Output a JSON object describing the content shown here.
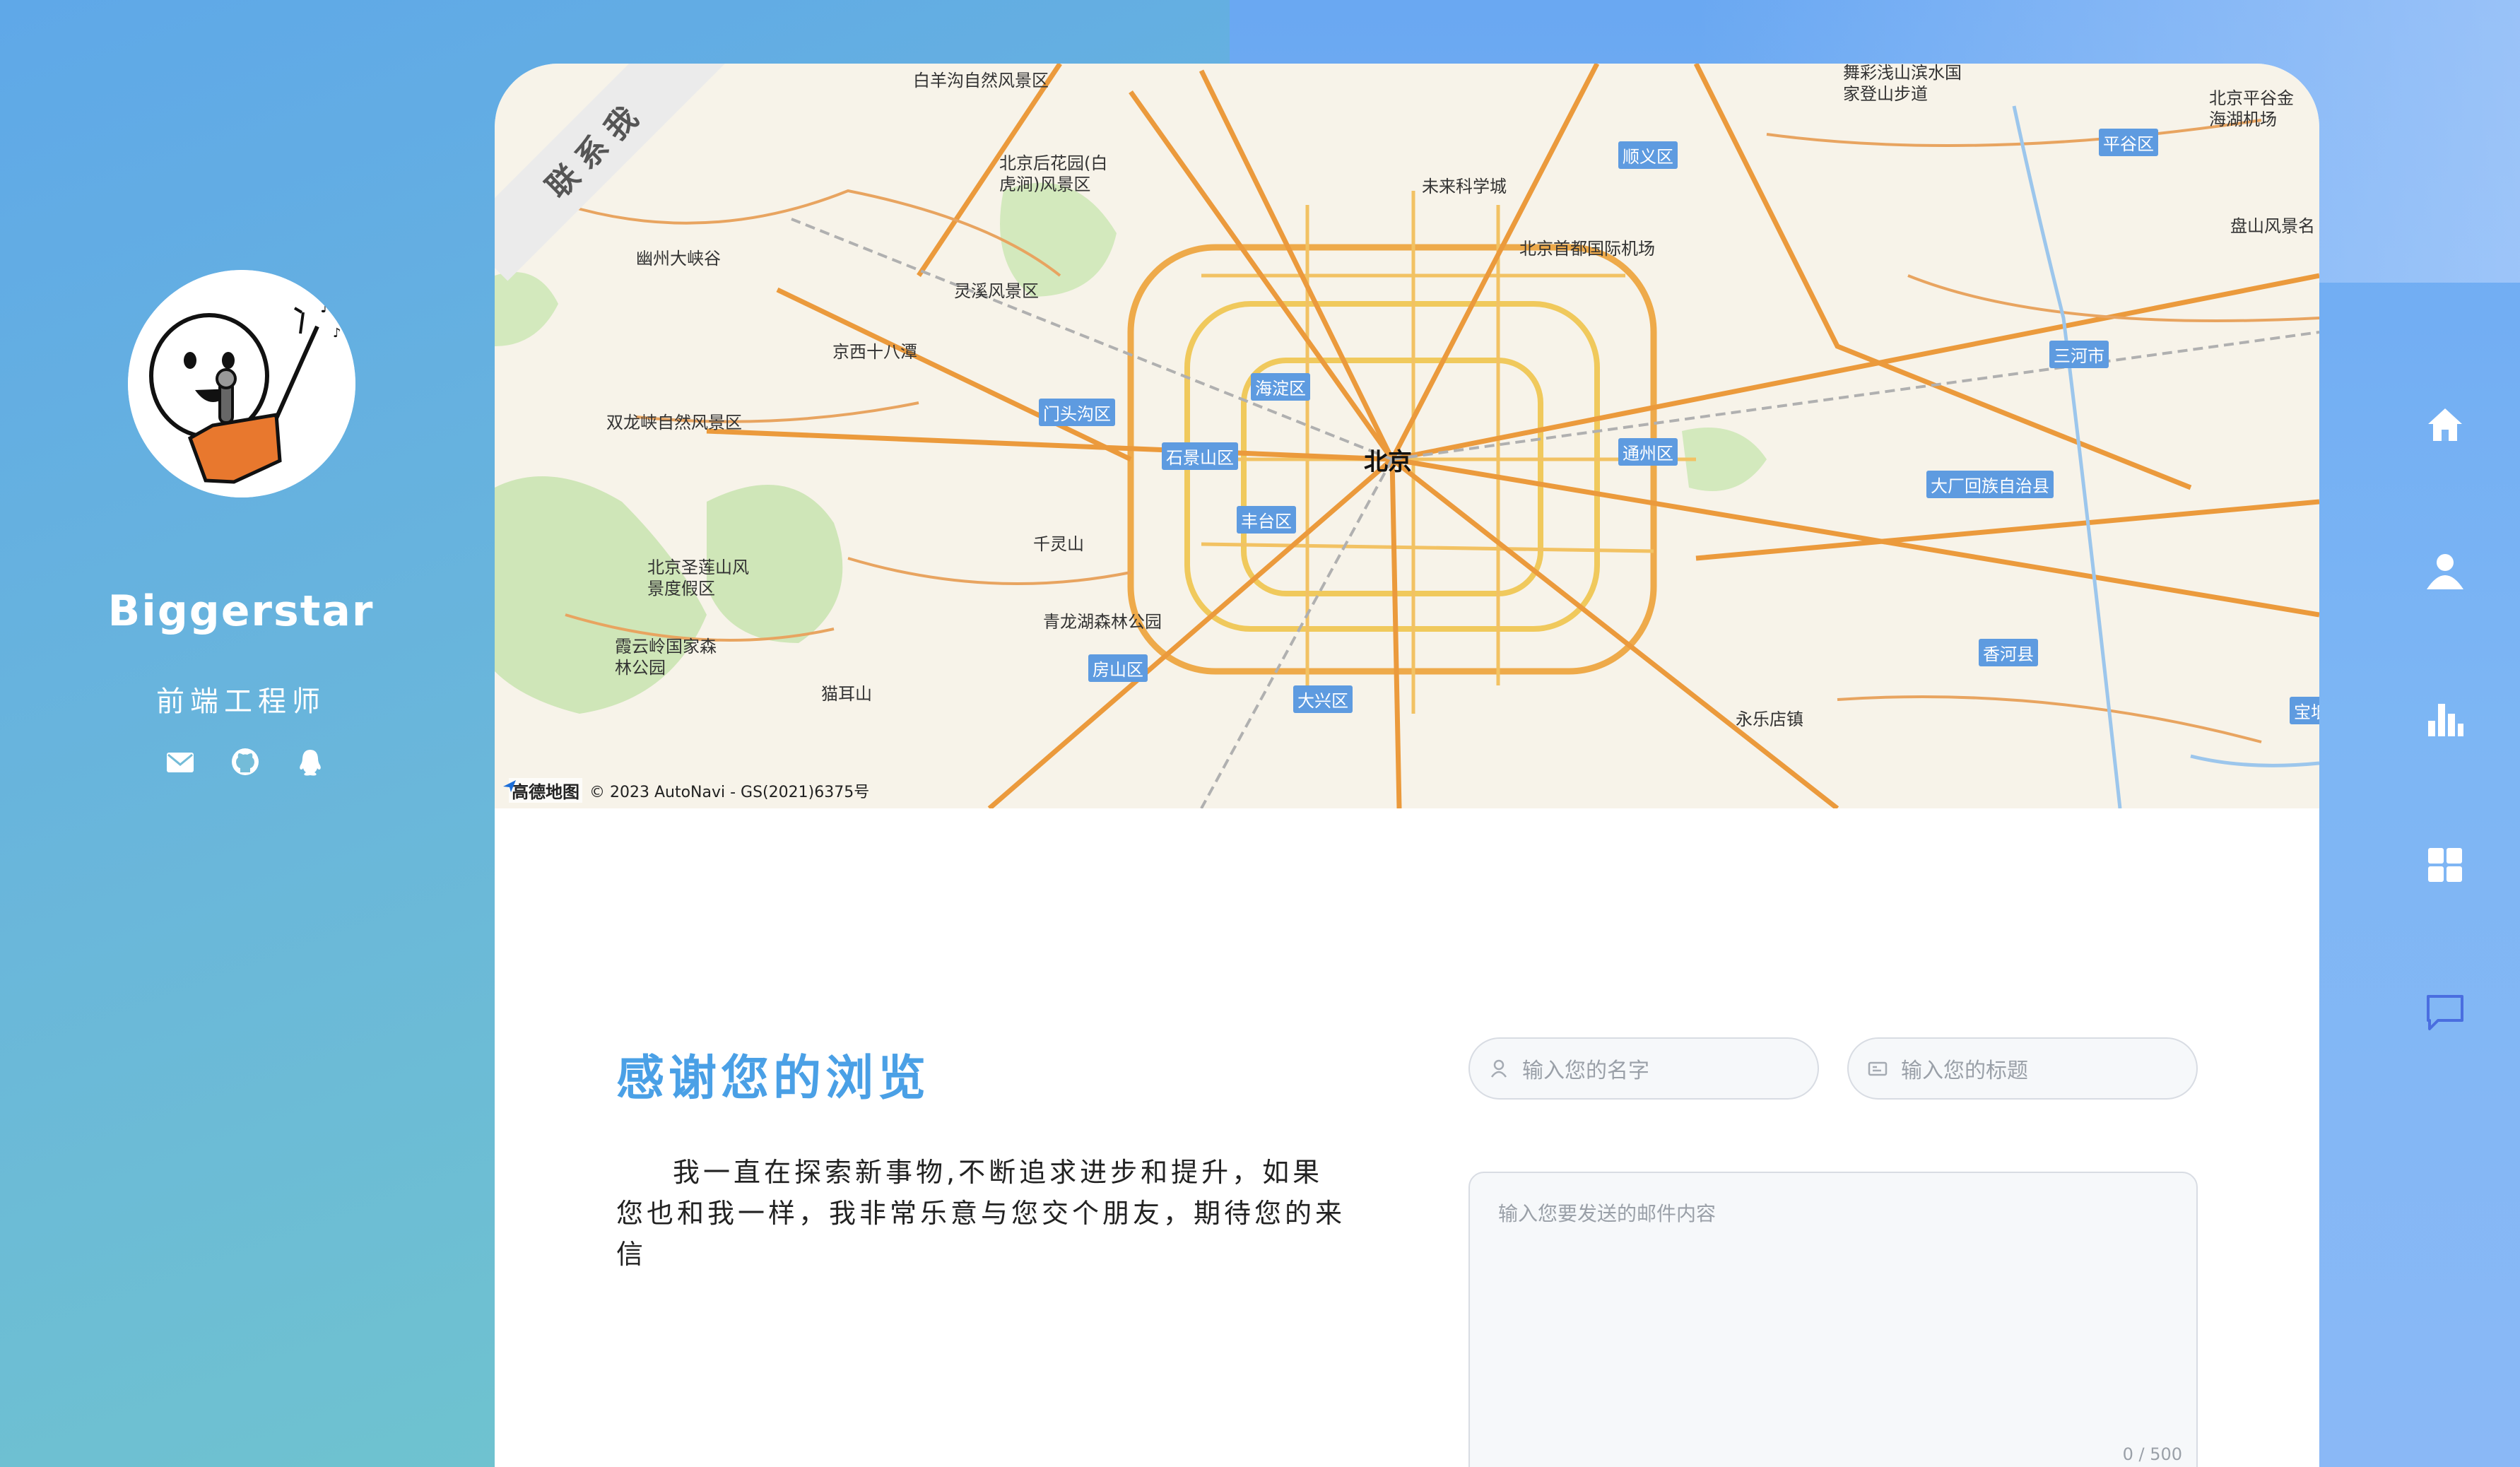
{
  "profile": {
    "name": "Biggerstar",
    "title": "前端工程师",
    "social_icons": [
      "mail-icon",
      "github-icon",
      "qq-icon"
    ]
  },
  "ribbon": "联系我",
  "map": {
    "city": "北京",
    "attribution_brand": "高德地图",
    "attribution_text": "© 2023 AutoNavi - GS(2021)6375号",
    "districts": [
      "顺义区",
      "平谷区",
      "海淀区",
      "门头沟区",
      "石景山区",
      "丰台区",
      "通州区",
      "三河市",
      "大厂回族自治县",
      "房山区",
      "大兴区",
      "香河县",
      "宝坻"
    ],
    "places": [
      "白羊沟自然风景区",
      "舞彩浅山滨水国家登山步道",
      "北京平谷金海湖机场",
      "北京后花园(白虎涧)风景区",
      "未来科学城",
      "北京首都国际机场",
      "幽州大峡谷",
      "灵溪风景区",
      "京西十八潭",
      "双龙峡自然风景区",
      "千灵山",
      "北京圣莲山风景度假区",
      "青龙湖森林公园",
      "霞云岭国家森林公园",
      "猫耳山",
      "永乐店镇",
      "盘山风景名"
    ]
  },
  "main": {
    "thanks_title": "感谢您的浏览",
    "thanks_text": "我一直在探索新事物,不断追求进步和提升，如果您也和我一样，我非常乐意与您交个朋友，期待您的来信"
  },
  "form": {
    "name_placeholder": "输入您的名字",
    "subject_placeholder": "输入您的标题",
    "message_placeholder": "输入您要发送的邮件内容",
    "counter": "0 / 500"
  },
  "nav_icons": [
    "home-icon",
    "user-icon",
    "chart-icon",
    "grid-icon",
    "message-icon"
  ],
  "colors": {
    "accent": "#4aa0e6",
    "nav_active": "#4a6ee0"
  }
}
